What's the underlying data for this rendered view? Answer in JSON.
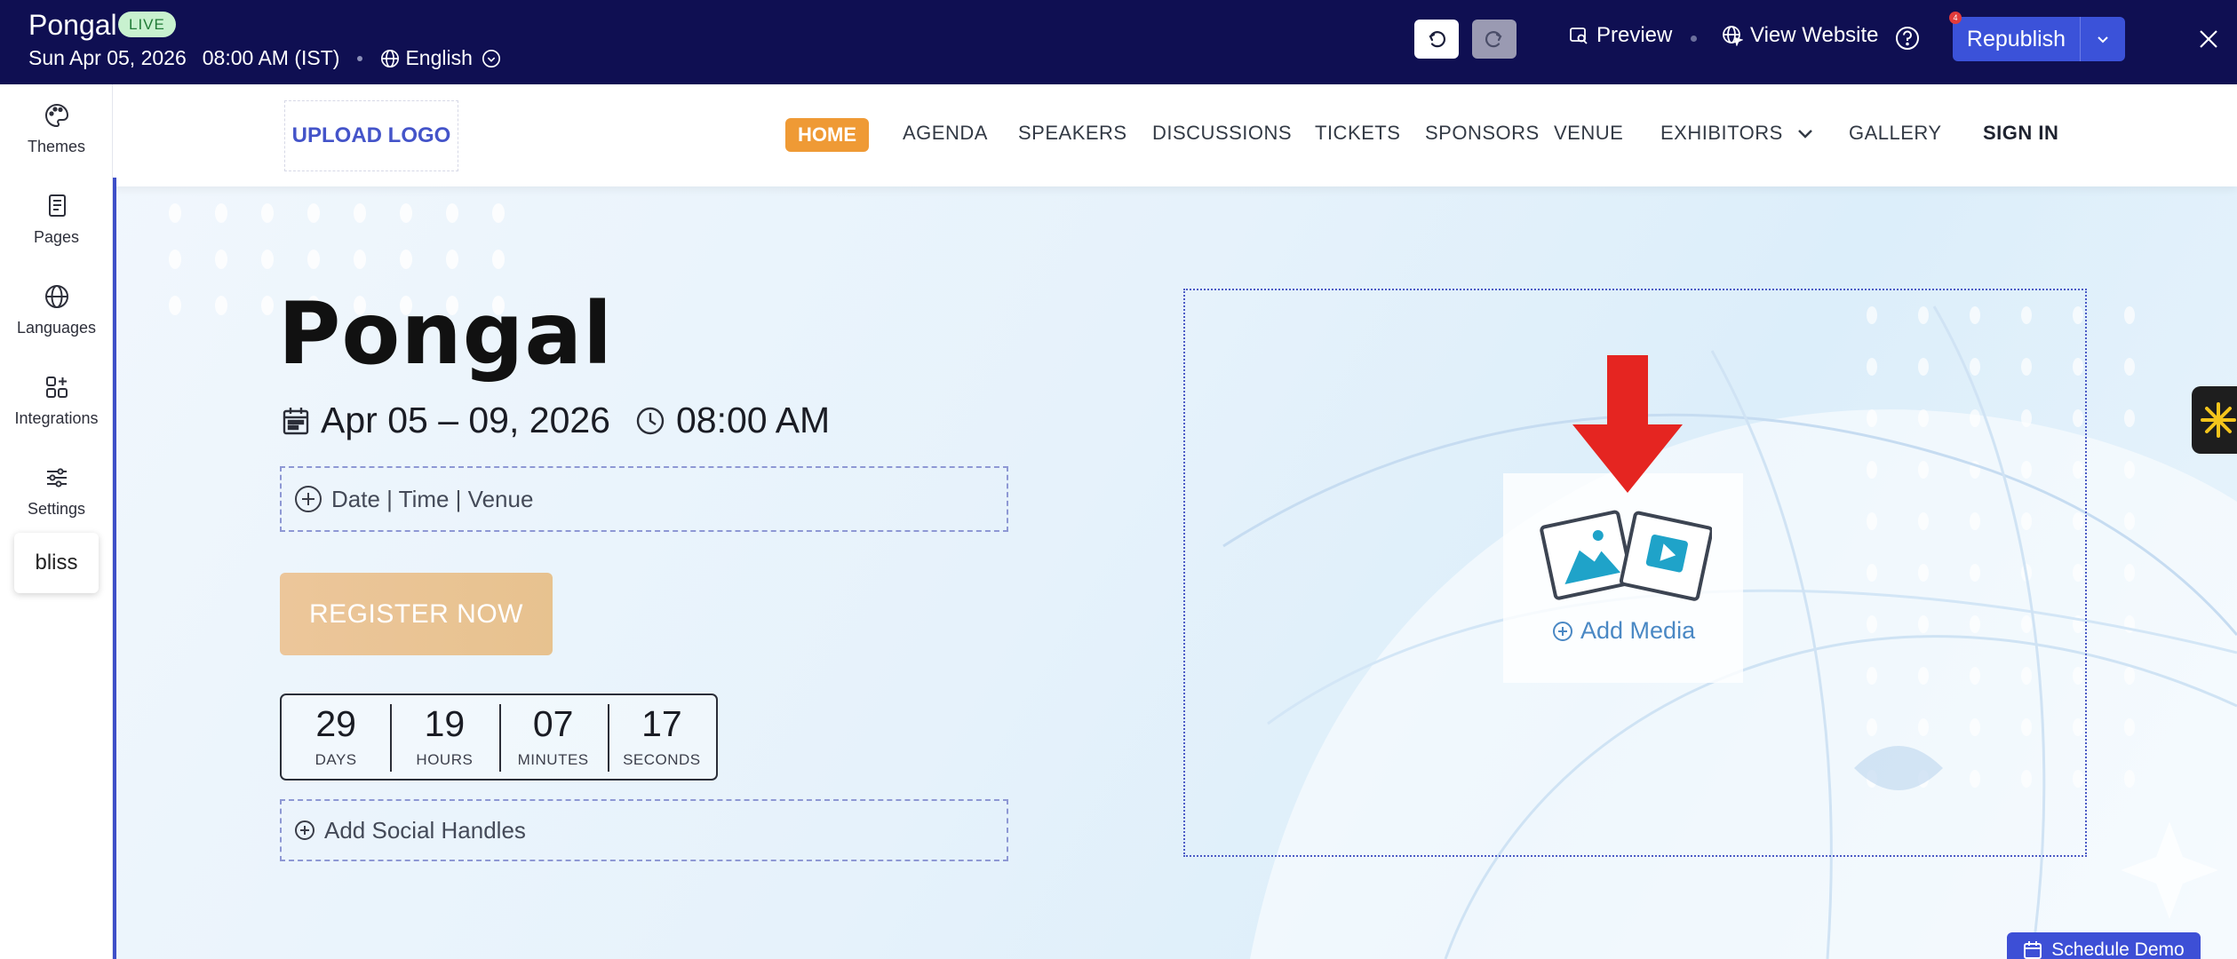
{
  "topbar": {
    "event_title": "Pongal",
    "live_badge": "LIVE",
    "date": "Sun Apr 05, 2026",
    "time": "08:00 AM (IST)",
    "language": "English",
    "preview_label": "Preview",
    "view_website_label": "View Website",
    "republish_label": "Republish",
    "notification_count": "4"
  },
  "sidebar": {
    "items": [
      {
        "label": "Themes",
        "icon": "palette-icon"
      },
      {
        "label": "Pages",
        "icon": "pages-icon"
      },
      {
        "label": "Languages",
        "icon": "globe-icon"
      },
      {
        "label": "Integrations",
        "icon": "integrations-icon"
      },
      {
        "label": "Settings",
        "icon": "sliders-icon"
      }
    ],
    "chip_label": "bliss"
  },
  "site_nav": {
    "upload_logo": "UPLOAD LOGO",
    "items": [
      "HOME",
      "AGENDA",
      "SPEAKERS",
      "DISCUSSIONS",
      "TICKETS",
      "SPONSORS",
      "VENUE",
      "EXHIBITORS",
      "GALLERY",
      "SIGN IN"
    ],
    "active": "HOME"
  },
  "hero": {
    "title": "Pongal",
    "date_range": "Apr 05 – 09, 2026",
    "start_time": "08:00 AM",
    "date_time_venue": "Date | Time | Venue",
    "register_label": "REGISTER NOW",
    "social_label": "Add Social Handles",
    "add_media_label": "Add Media"
  },
  "countdown": [
    {
      "value": "29",
      "label": "DAYS"
    },
    {
      "value": "19",
      "label": "HOURS"
    },
    {
      "value": "07",
      "label": "MINUTES"
    },
    {
      "value": "17",
      "label": "SECONDS"
    }
  ],
  "schedule_demo_label": "Schedule Demo",
  "colors": {
    "topbar_bg": "#0f0f52",
    "accent": "#3b52d9",
    "home_active": "#ef9a35",
    "register_btn": "#ecc69a",
    "arrow": "#e52521"
  }
}
